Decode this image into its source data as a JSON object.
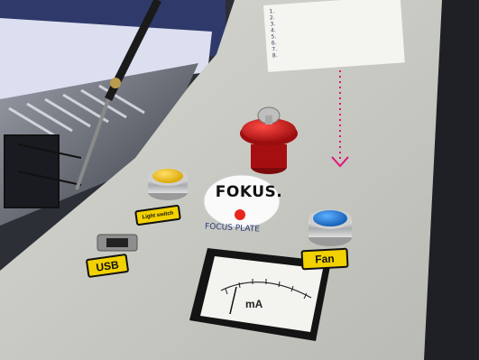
{
  "panel": {
    "buttons": {
      "light": {
        "label": "Light switch",
        "color": "#f2c21a"
      },
      "fan": {
        "label": "Fan",
        "color": "#1d78d6"
      },
      "emergency_stop": {
        "color": "#c8171b"
      }
    },
    "usb_label": "USB",
    "focus_disc": {
      "text": "FOKUS.",
      "handwriting": "FOCUS PLATE"
    },
    "meter": {
      "unit": "mA"
    },
    "note_lines": [
      "1. ",
      "2. ",
      "3. ",
      "4. ",
      "5. ",
      "6. ",
      "7. ",
      "8. "
    ],
    "guide_line_color": "#e0147c",
    "label_color": "#f2d100"
  }
}
